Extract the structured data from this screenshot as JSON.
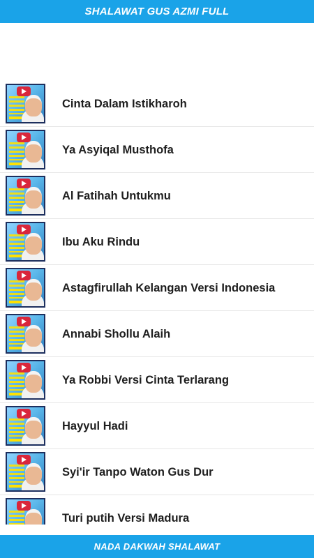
{
  "header": {
    "title": "SHALAWAT GUS AZMI FULL"
  },
  "songs": [
    {
      "label": "Cinta Dalam Istikharoh"
    },
    {
      "label": "Ya Asyiqal Musthofa"
    },
    {
      "label": "Al Fatihah Untukmu"
    },
    {
      "label": "Ibu Aku Rindu"
    },
    {
      "label": "Astagfirullah Kelangan Versi Indonesia"
    },
    {
      "label": "Annabi Shollu Alaih"
    },
    {
      "label": "Ya Robbi Versi Cinta Terlarang"
    },
    {
      "label": "Hayyul Hadi"
    },
    {
      "label": "Syi'ir Tanpo Waton Gus Dur"
    },
    {
      "label": "Turi putih Versi Madura"
    }
  ],
  "footer": {
    "label": "NADA DAKWAH SHALAWAT"
  },
  "colors": {
    "accent": "#1aa3e8",
    "text": "#1e1e1e",
    "divider": "#e6e6e6"
  }
}
